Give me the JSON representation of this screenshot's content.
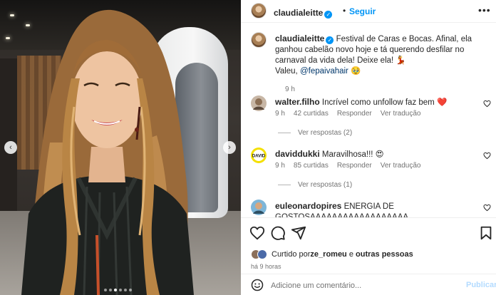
{
  "header": {
    "username": "claudialeitte",
    "verified_icon": "verified-badge-icon",
    "separator": "•",
    "follow_label": "Seguir",
    "more_icon": "more-options-icon",
    "more_label": "•••"
  },
  "media": {
    "prev_icon": "chevron-left-icon",
    "next_icon": "chevron-right-icon",
    "prev_glyph": "‹",
    "next_glyph": "›",
    "slide_count": 6,
    "active_slide": 3
  },
  "caption": {
    "username": "claudialeitte",
    "text_before": "Festival de Caras e Bocas. Afinal, ela ganhou cabelão novo hoje e tá querendo desfilar no carnaval da vida dela! Deixe ela! 💃",
    "text_thanks": "Valeu, ",
    "mention": "@fepaivahair",
    "text_after": " 🥹",
    "time": "9 h"
  },
  "comments": [
    {
      "username": "walter.filho",
      "text": "Incrível como unfollow faz bem ❤️",
      "time": "9 h",
      "likes": "42 curtidas",
      "reply_label": "Responder",
      "translate_label": "Ver tradução",
      "replies_label": "Ver respostas (2)"
    },
    {
      "username": "daviddukki",
      "text": "Maravilhosa!!! 😍",
      "time": "9 h",
      "likes": "85 curtidas",
      "reply_label": "Responder",
      "translate_label": "Ver tradução",
      "replies_label": "Ver respostas (1)"
    },
    {
      "username": "euleonardopires",
      "text": "ENERGIA DE GOSTOSAAAAAAAAAAAAAAAAAA",
      "emoji_line": "🔥🔥🔥"
    }
  ],
  "actions": {
    "like_icon": "heart-icon",
    "comment_icon": "comment-icon",
    "share_icon": "share-icon",
    "save_icon": "bookmark-icon",
    "liked_by_prefix": "Curtido por ",
    "liked_by_user": "ze_romeu",
    "liked_by_suffix": " e ",
    "liked_by_others": "outras pessoas",
    "time_ago": "há 9 horas"
  },
  "add_comment": {
    "emoji_icon": "emoji-icon",
    "placeholder": "Adicione um comentário...",
    "publish_label": "Publicar"
  },
  "colors": {
    "accent": "#0095f6",
    "mention": "#00376b",
    "muted": "#737373",
    "publish_disabled": "#b3dbff"
  }
}
